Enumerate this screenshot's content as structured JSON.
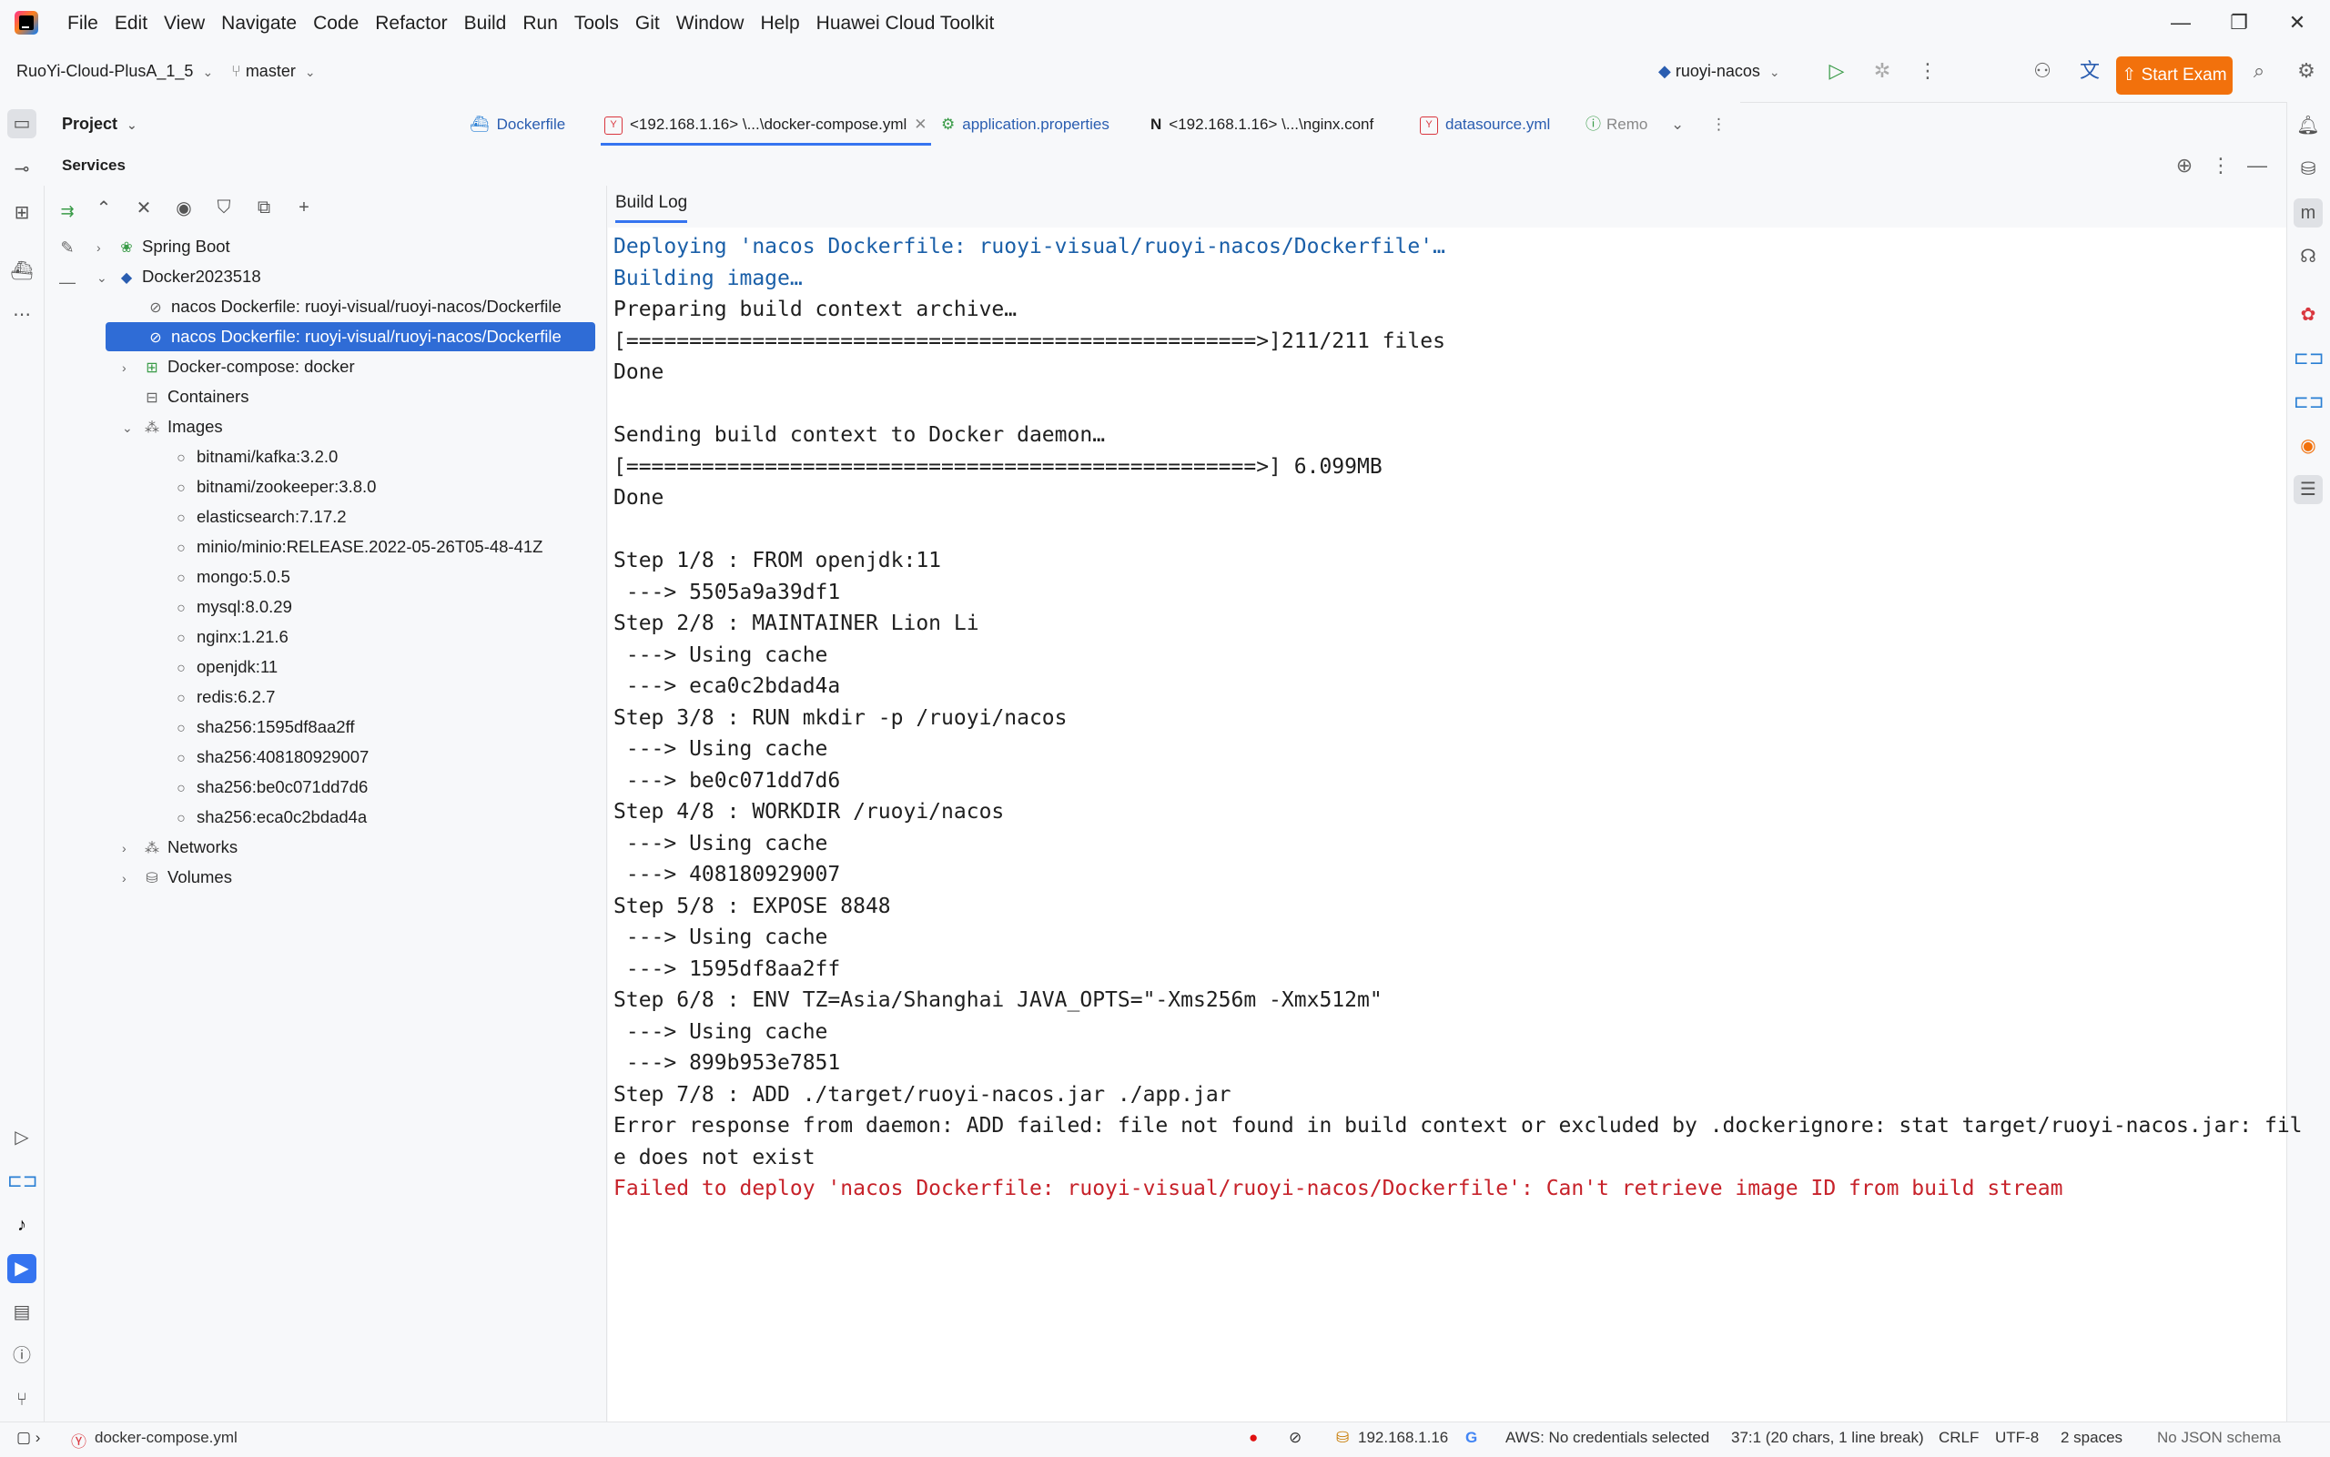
{
  "menu": [
    "File",
    "Edit",
    "View",
    "Navigate",
    "Code",
    "Refactor",
    "Build",
    "Run",
    "Tools",
    "Git",
    "Window",
    "Help",
    "Huawei Cloud Toolkit"
  ],
  "toolbar": {
    "project": "RuoYi-Cloud-PlusA_1_5",
    "branch": "master",
    "run_config": "ruoyi-nacos",
    "start_exam": "Start Exam"
  },
  "project_panel": {
    "label": "Project"
  },
  "tabs": [
    {
      "label": "Dockerfile"
    },
    {
      "label": "<192.168.1.16> \\...\\docker-compose.yml"
    },
    {
      "label": "application.properties"
    },
    {
      "label": "<192.168.1.16> \\...\\nginx.conf"
    },
    {
      "label": "datasource.yml"
    },
    {
      "label": "Remo"
    }
  ],
  "services": {
    "title": "Services",
    "tree": [
      {
        "label": "Spring Boot"
      },
      {
        "label": "Docker2023518"
      },
      {
        "label": "nacos Dockerfile: ruoyi-visual/ruoyi-nacos/Dockerfile"
      },
      {
        "label": "nacos Dockerfile: ruoyi-visual/ruoyi-nacos/Dockerfile"
      },
      {
        "label": "Docker-compose: docker"
      },
      {
        "label": "Containers"
      },
      {
        "label": "Images"
      },
      {
        "label": "bitnami/kafka:3.2.0"
      },
      {
        "label": "bitnami/zookeeper:3.8.0"
      },
      {
        "label": "elasticsearch:7.17.2"
      },
      {
        "label": "minio/minio:RELEASE.2022-05-26T05-48-41Z"
      },
      {
        "label": "mongo:5.0.5"
      },
      {
        "label": "mysql:8.0.29"
      },
      {
        "label": "nginx:1.21.6"
      },
      {
        "label": "openjdk:11"
      },
      {
        "label": "redis:6.2.7"
      },
      {
        "label": "sha256:1595df8aa2ff"
      },
      {
        "label": "sha256:408180929007"
      },
      {
        "label": "sha256:be0c071dd7d6"
      },
      {
        "label": "sha256:eca0c2bdad4a"
      },
      {
        "label": "Networks"
      },
      {
        "label": "Volumes"
      }
    ]
  },
  "build_log": {
    "tab": "Build Log",
    "lines": [
      "Deploying 'nacos Dockerfile: ruoyi-visual/ruoyi-nacos/Dockerfile'…",
      "Building image…",
      "Preparing build context archive…",
      "[==================================================>]211/211 files",
      "Done",
      "",
      "Sending build context to Docker daemon…",
      "[==================================================>] 6.099MB",
      "Done",
      "",
      "Step 1/8 : FROM openjdk:11",
      " ---> 5505a9a39df1",
      "Step 2/8 : MAINTAINER Lion Li",
      " ---> Using cache",
      " ---> eca0c2bdad4a",
      "Step 3/8 : RUN mkdir -p /ruoyi/nacos",
      " ---> Using cache",
      " ---> be0c071dd7d6",
      "Step 4/8 : WORKDIR /ruoyi/nacos",
      " ---> Using cache",
      " ---> 408180929007",
      "Step 5/8 : EXPOSE 8848",
      " ---> Using cache",
      " ---> 1595df8aa2ff",
      "Step 6/8 : ENV TZ=Asia/Shanghai JAVA_OPTS=\"-Xms256m -Xmx512m\"",
      " ---> Using cache",
      " ---> 899b953e7851",
      "Step 7/8 : ADD ./target/ruoyi-nacos.jar ./app.jar",
      "Error response from daemon: ADD failed: file not found in build context or excluded by .dockerignore: stat target/ruoyi-nacos.jar: fil",
      "e does not exist",
      "Failed to deploy 'nacos Dockerfile: ruoyi-visual/ruoyi-nacos/Dockerfile': Can't retrieve image ID from build stream"
    ]
  },
  "status": {
    "file": "docker-compose.yml",
    "host": "192.168.1.16",
    "aws": "AWS: No credentials selected",
    "position": "37:1 (20 chars, 1 line break)",
    "line_sep": "CRLF",
    "encoding": "UTF-8",
    "indent": "2 spaces",
    "schema": "No JSON schema"
  },
  "colors": {
    "accent": "#3574f0",
    "selection": "#2f6cd6",
    "info_text": "#1a5fa8",
    "error_text": "#c7222a",
    "start_exam": "#f2710c"
  }
}
